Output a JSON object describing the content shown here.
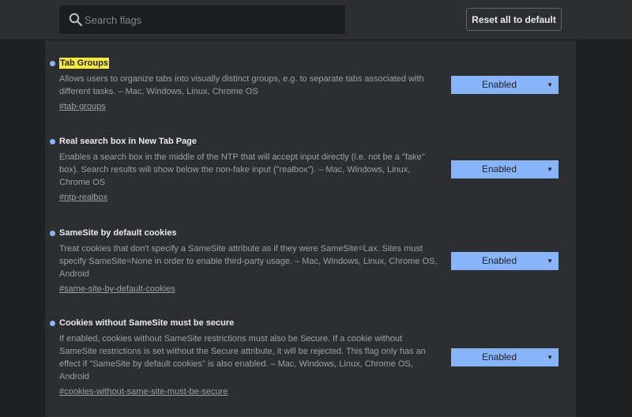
{
  "search": {
    "placeholder": "Search flags",
    "value": ""
  },
  "header": {
    "reset_label": "Reset all to default"
  },
  "flags": [
    {
      "title": "Tab Groups",
      "description": "Allows users to organize tabs into visually distinct groups, e.g. to separate tabs associated with different tasks. – Mac, Windows, Linux, Chrome OS",
      "link": "#tab-groups",
      "value": "Enabled",
      "highlighted": true
    },
    {
      "title": "Real search box in New Tab Page",
      "description": "Enables a search box in the middle of the NTP that will accept input directly (i.e. not be a \"fake\" box). Search results will show below the non-fake input (\"realbox\"). – Mac, Windows, Linux, Chrome OS",
      "link": "#ntp-realbox",
      "value": "Enabled",
      "highlighted": false
    },
    {
      "title": "SameSite by default cookies",
      "description": "Treat cookies that don't specify a SameSite attribute as if they were SameSite=Lax. Sites must specify SameSite=None in order to enable third-party usage. – Mac, Windows, Linux, Chrome OS, Android",
      "link": "#same-site-by-default-cookies",
      "value": "Enabled",
      "highlighted": false
    },
    {
      "title": "Cookies without SameSite must be secure",
      "description": "If enabled, cookies without SameSite restrictions must also be Secure. If a cookie without SameSite restrictions is set without the Secure attribute, it will be rejected. This flag only has an effect if \"SameSite by default cookies\" is also enabled. – Mac, Windows, Linux, Chrome OS, Android",
      "link": "#cookies-without-same-site-must-be-secure",
      "value": "Enabled",
      "highlighted": false
    }
  ],
  "icons": {
    "search": "search-icon",
    "dropdown": "chevron-down-icon"
  },
  "colors": {
    "accent": "#8ab4f8",
    "highlight": "#ffeb3b",
    "background": "#202124",
    "panel": "#2d2e31"
  }
}
